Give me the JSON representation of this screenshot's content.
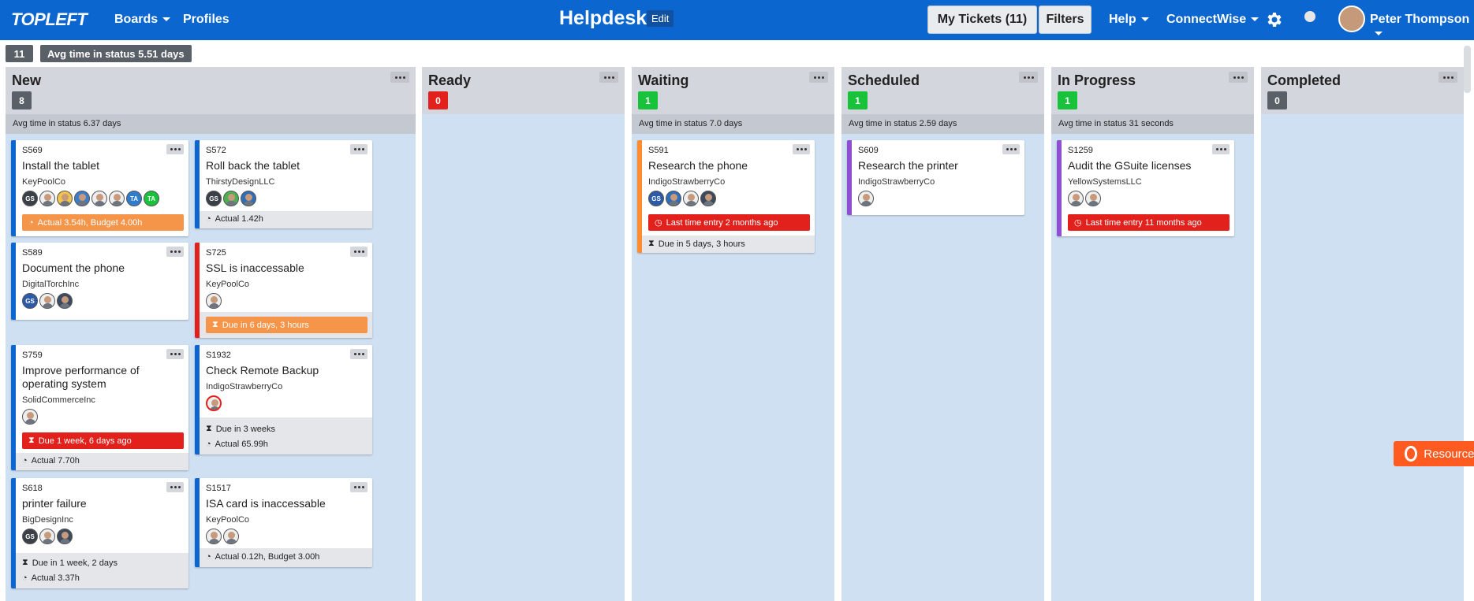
{
  "topbar": {
    "logo": "TOPLEFT",
    "boards": "Boards",
    "profiles": "Profiles",
    "board_title": "Helpdesk",
    "edit": "Edit",
    "my_tickets": "My Tickets (11)",
    "filters": "Filters",
    "help": "Help",
    "connectwise": "ConnectWise",
    "user_name": "Peter Thompson"
  },
  "summary": {
    "count": "11",
    "avg": "Avg time in status 5.51 days"
  },
  "columns": [
    {
      "title": "New",
      "count": "8",
      "count_color": "#5a6068",
      "avg": "Avg time in status 6.37 days"
    },
    {
      "title": "Ready",
      "count": "0",
      "count_color": "#e3211c",
      "avg": ""
    },
    {
      "title": "Waiting",
      "count": "1",
      "count_color": "#18c23a",
      "avg": "Avg time in status 7.0 days"
    },
    {
      "title": "Scheduled",
      "count": "1",
      "count_color": "#18c23a",
      "avg": "Avg time in status 2.59 days"
    },
    {
      "title": "In Progress",
      "count": "1",
      "count_color": "#18c23a",
      "avg": "Avg time in status 31 seconds"
    },
    {
      "title": "Completed",
      "count": "0",
      "count_color": "#5a6068",
      "avg": ""
    }
  ],
  "cards": {
    "s569": {
      "id": "S569",
      "title": "Install the tablet",
      "company": "KeyPoolCo",
      "avatars": [
        "GS",
        "TA",
        "TA"
      ],
      "badge": "Actual 3.54h, Budget 4.00h"
    },
    "s572": {
      "id": "S572",
      "title": "Roll back the tablet",
      "company": "ThirstyDesignLLC",
      "avatars": [
        "GS"
      ],
      "actual": "Actual 1.42h"
    },
    "s589": {
      "id": "S589",
      "title": "Document the phone",
      "company": "DigitalTorchInc",
      "avatars": [
        "GS"
      ]
    },
    "s725": {
      "id": "S725",
      "title": "SSL is inaccessable",
      "company": "KeyPoolCo",
      "badge": "Due in 6 days, 3 hours"
    },
    "s759": {
      "id": "S759",
      "title": "Improve performance of operating system",
      "company": "SolidCommerceInc",
      "badge": "Due 1 week, 6 days ago",
      "actual": "Actual 7.70h"
    },
    "s1932": {
      "id": "S1932",
      "title": "Check Remote Backup",
      "company": "IndigoStrawberryCo",
      "due": "Due in 3 weeks",
      "actual": "Actual 65.99h"
    },
    "s618": {
      "id": "S618",
      "title": "printer failure",
      "company": "BigDesignInc",
      "avatars": [
        "GS"
      ],
      "due": "Due in 1 week, 2 days",
      "actual": "Actual 3.37h"
    },
    "s1517": {
      "id": "S1517",
      "title": "ISA card is inaccessable",
      "company": "KeyPoolCo",
      "actual": "Actual 0.12h, Budget 3.00h"
    },
    "s591": {
      "id": "S591",
      "title": "Research the phone",
      "company": "IndigoStrawberryCo",
      "avatars": [
        "GS"
      ],
      "badge": "Last time entry 2 months ago",
      "due": "Due in 5 days, 3 hours"
    },
    "s609": {
      "id": "S609",
      "title": "Research the printer",
      "company": "IndigoStrawberryCo"
    },
    "s1259": {
      "id": "S1259",
      "title": "Audit the GSuite licenses",
      "company": "YellowSystemsLLC",
      "badge": "Last time entry 11 months ago"
    }
  },
  "resources": "Resources",
  "colors": {
    "brand": "#0b66d0",
    "danger": "#e3211c",
    "warning": "#f5954a",
    "success": "#18c23a",
    "purple": "#8e4fd1",
    "orange": "#ff8c2e"
  }
}
